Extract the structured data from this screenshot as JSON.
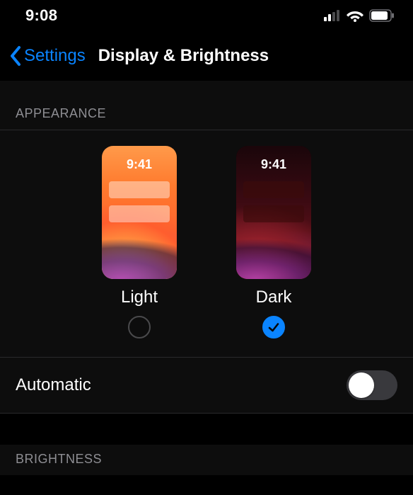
{
  "status": {
    "time": "9:08"
  },
  "nav": {
    "back_label": "Settings",
    "title": "Display & Brightness"
  },
  "appearance": {
    "header": "APPEARANCE",
    "preview_time": "9:41",
    "options": {
      "light": {
        "label": "Light",
        "selected": false
      },
      "dark": {
        "label": "Dark",
        "selected": true
      }
    }
  },
  "automatic": {
    "label": "Automatic",
    "value": false
  },
  "brightness": {
    "header": "BRIGHTNESS"
  },
  "colors": {
    "accent": "#0a84ff"
  }
}
